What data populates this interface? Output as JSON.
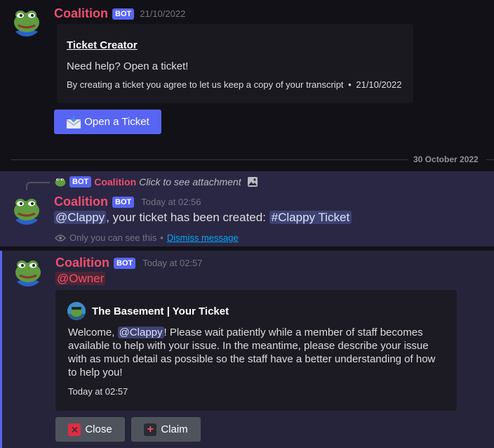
{
  "message1": {
    "username": "Coalition",
    "bot_tag": "BOT",
    "timestamp": "21/10/2022",
    "embed": {
      "title": "Ticket Creator",
      "description": "Need help? Open a ticket!",
      "footer": "By creating a ticket you agree to let us keep a copy of your transcript",
      "footer_sep": "•",
      "footer_date": "21/10/2022"
    },
    "button": {
      "icon": "envelope-icon",
      "label": "Open a Ticket"
    }
  },
  "date_divider": "30 October 2022",
  "message2": {
    "reply": {
      "bot_tag": "BOT",
      "username": "Coalition",
      "text": "Click to see attachment"
    },
    "username": "Coalition",
    "bot_tag": "BOT",
    "timestamp": "Today at 02:56",
    "mention": "@Clappy",
    "text": ", your ticket has been created: ",
    "channel_hash": "#",
    "channel": "Clappy Ticket",
    "ephemeral_text": "Only you can see this",
    "ephemeral_sep": "•",
    "dismiss": "Dismiss message"
  },
  "message3": {
    "username": "Coalition",
    "bot_tag": "BOT",
    "timestamp": "Today at 02:57",
    "role_mention": "@Owner",
    "embed": {
      "author": "The Basement | Your Ticket",
      "desc_before": "Welcome, ",
      "desc_mention": "@Clappy",
      "desc_after": "! Please wait patiently while a member of staff becomes available to help with your issue. In the meantime, please describe your issue with as much detail as possible so the staff have a better understanding of how to help you!",
      "footer": "Today at 02:57"
    },
    "buttons": [
      {
        "icon": "close-icon",
        "glyph": "✕",
        "label": "Close"
      },
      {
        "icon": "plus-icon",
        "glyph": "+",
        "label": "Claim"
      }
    ]
  },
  "colors": {
    "accent": "#5865f2",
    "username": "#f0506e",
    "highlight_bg": "#2a2744",
    "background": "#121118"
  }
}
